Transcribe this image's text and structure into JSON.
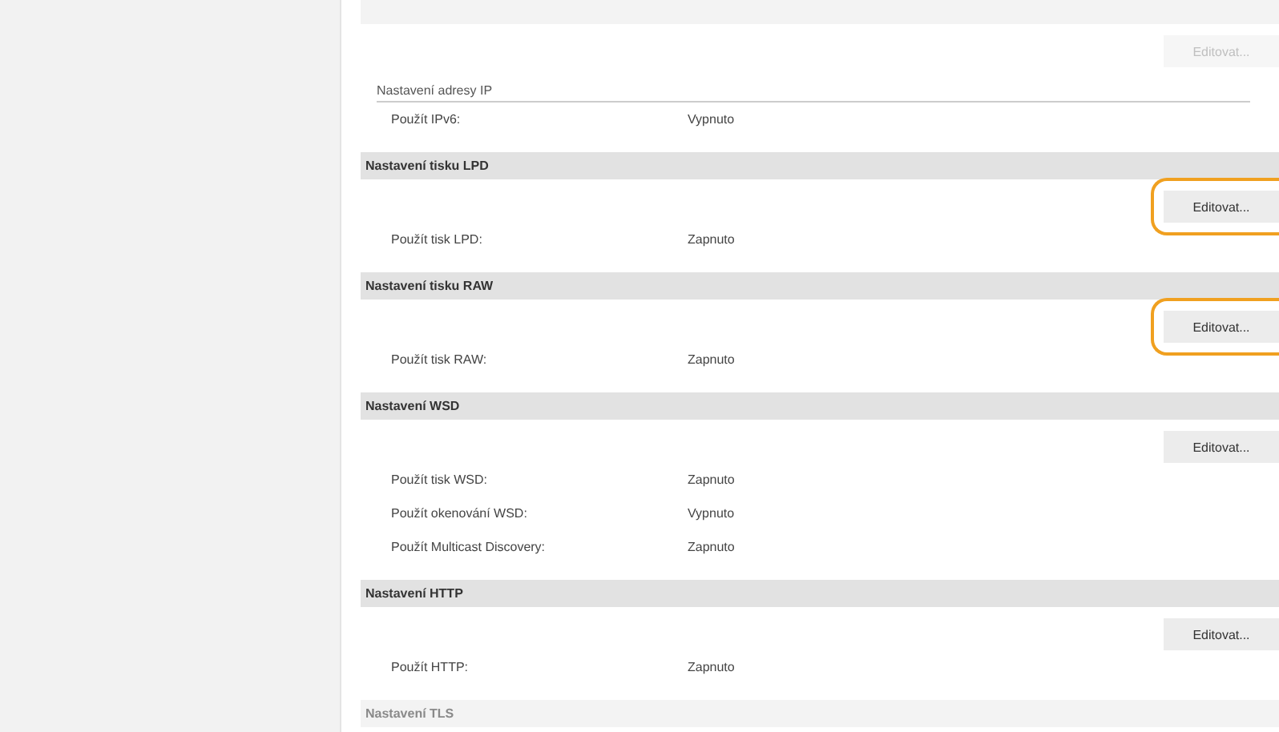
{
  "sections": [
    {
      "faded": true,
      "button": {
        "label": "Editovat...",
        "disabled": true,
        "highlighted": false
      },
      "subheading": "Nastavení adresy IP",
      "rows": [
        {
          "label": "Použít IPv6:",
          "value": "Vypnuto"
        }
      ]
    },
    {
      "title": "Nastavení tisku LPD",
      "faded": false,
      "button": {
        "label": "Editovat...",
        "disabled": false,
        "highlighted": true
      },
      "rows": [
        {
          "label": "Použít tisk LPD:",
          "value": "Zapnuto"
        }
      ]
    },
    {
      "title": "Nastavení tisku RAW",
      "faded": false,
      "button": {
        "label": "Editovat...",
        "disabled": false,
        "highlighted": true
      },
      "rows": [
        {
          "label": "Použít tisk RAW:",
          "value": "Zapnuto"
        }
      ]
    },
    {
      "title": "Nastavení WSD",
      "faded": false,
      "button": {
        "label": "Editovat...",
        "disabled": false,
        "highlighted": false
      },
      "rows": [
        {
          "label": "Použít tisk WSD:",
          "value": "Zapnuto"
        },
        {
          "label": "Použít okenování WSD:",
          "value": "Vypnuto"
        },
        {
          "label": "Použít Multicast Discovery:",
          "value": "Zapnuto"
        }
      ]
    },
    {
      "title": "Nastavení HTTP",
      "faded": false,
      "button": {
        "label": "Editovat...",
        "disabled": false,
        "highlighted": false
      },
      "rows": [
        {
          "label": "Použít HTTP:",
          "value": "Zapnuto"
        }
      ]
    },
    {
      "title": "Nastavení TLS",
      "faded": true
    }
  ]
}
